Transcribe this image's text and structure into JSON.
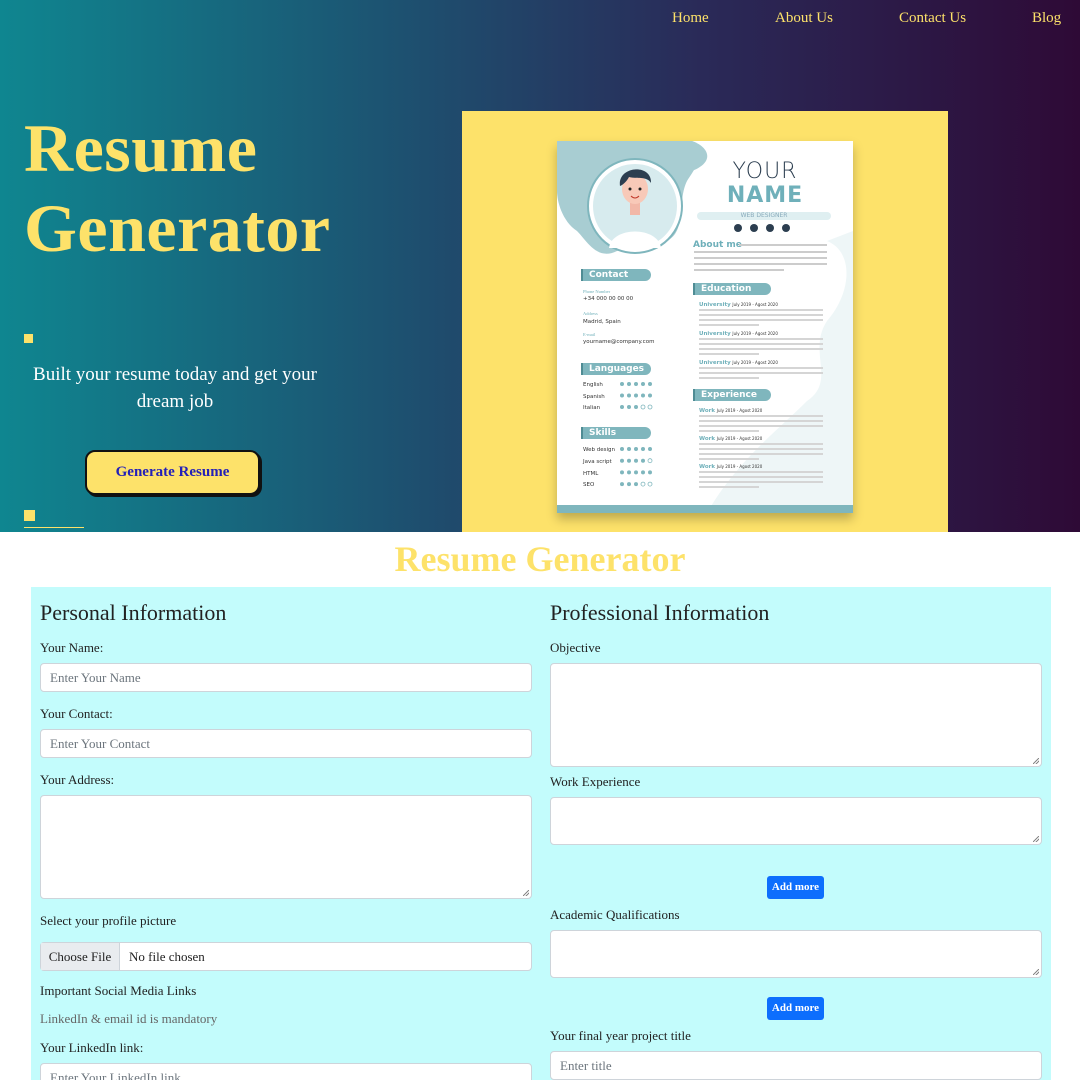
{
  "nav": {
    "items": [
      {
        "label": "Home"
      },
      {
        "label": "About Us"
      },
      {
        "label": "Contact Us"
      },
      {
        "label": "Blog"
      }
    ]
  },
  "hero": {
    "title_line1": "Resume",
    "title_line2": "Generator",
    "tagline": "Built your resume today and get your dream job",
    "cta_label": "Generate Resume",
    "accent_color": "#fde26a"
  },
  "resume_preview": {
    "your": "YOUR",
    "name": "NAME",
    "role": "WEB DESIGNER",
    "about_heading": "About me",
    "contact_heading": "Contact",
    "phone_label": "Phone Number",
    "phone_value": "+34 000 00 00 00",
    "address_label": "Address",
    "address_value": "Madrid, Spain",
    "email_label": "E-mail",
    "email_value": "yourname@company.com",
    "languages_heading": "Languages",
    "languages": [
      {
        "name": "English",
        "level": 5
      },
      {
        "name": "Spanish",
        "level": 5
      },
      {
        "name": "Italian",
        "level": 3
      }
    ],
    "skills_heading": "Skills",
    "skills": [
      {
        "name": "Web design",
        "level": 5
      },
      {
        "name": "Java script",
        "level": 4
      },
      {
        "name": "HTML",
        "level": 5
      },
      {
        "name": "SEO",
        "level": 3
      }
    ],
    "education_heading": "Education",
    "education": [
      {
        "title": "University",
        "dates": "July 2019 - Agost 2020"
      },
      {
        "title": "University",
        "dates": "July 2019 - Agost 2020"
      },
      {
        "title": "University",
        "dates": "July 2019 - Agost 2020"
      }
    ],
    "experience_heading": "Experience",
    "experience": [
      {
        "title": "Work",
        "dates": "July 2019 - Agost 2020"
      },
      {
        "title": "Work",
        "dates": "July 2019 - Agost 2020"
      },
      {
        "title": "Work",
        "dates": "July 2019 - Agost 2020"
      }
    ],
    "accent_color": "#7fb6bd"
  },
  "form": {
    "section_title": "Resume Generator",
    "personal": {
      "heading": "Personal Information",
      "name_label": "Your Name:",
      "name_placeholder": "Enter Your Name",
      "contact_label": "Your Contact:",
      "contact_placeholder": "Enter Your Contact",
      "address_label": "Your Address:",
      "picture_label": "Select your profile picture",
      "file_button": "Choose File",
      "file_status": "No file chosen",
      "social_label": "Important Social Media Links",
      "social_note": "LinkedIn & email id is mandatory",
      "linkedin_label": "Your LinkedIn link:",
      "linkedin_placeholder": "Enter Your LinkedIn link"
    },
    "professional": {
      "heading": "Professional Information",
      "objective_label": "Objective",
      "work_label": "Work Experience",
      "add_more_1": "Add more",
      "academic_label": "Academic Qualifications",
      "add_more_2": "Add more",
      "project_label": "Your final year project title",
      "project_placeholder": "Enter title"
    },
    "panel_color": "#c3fcfc"
  }
}
